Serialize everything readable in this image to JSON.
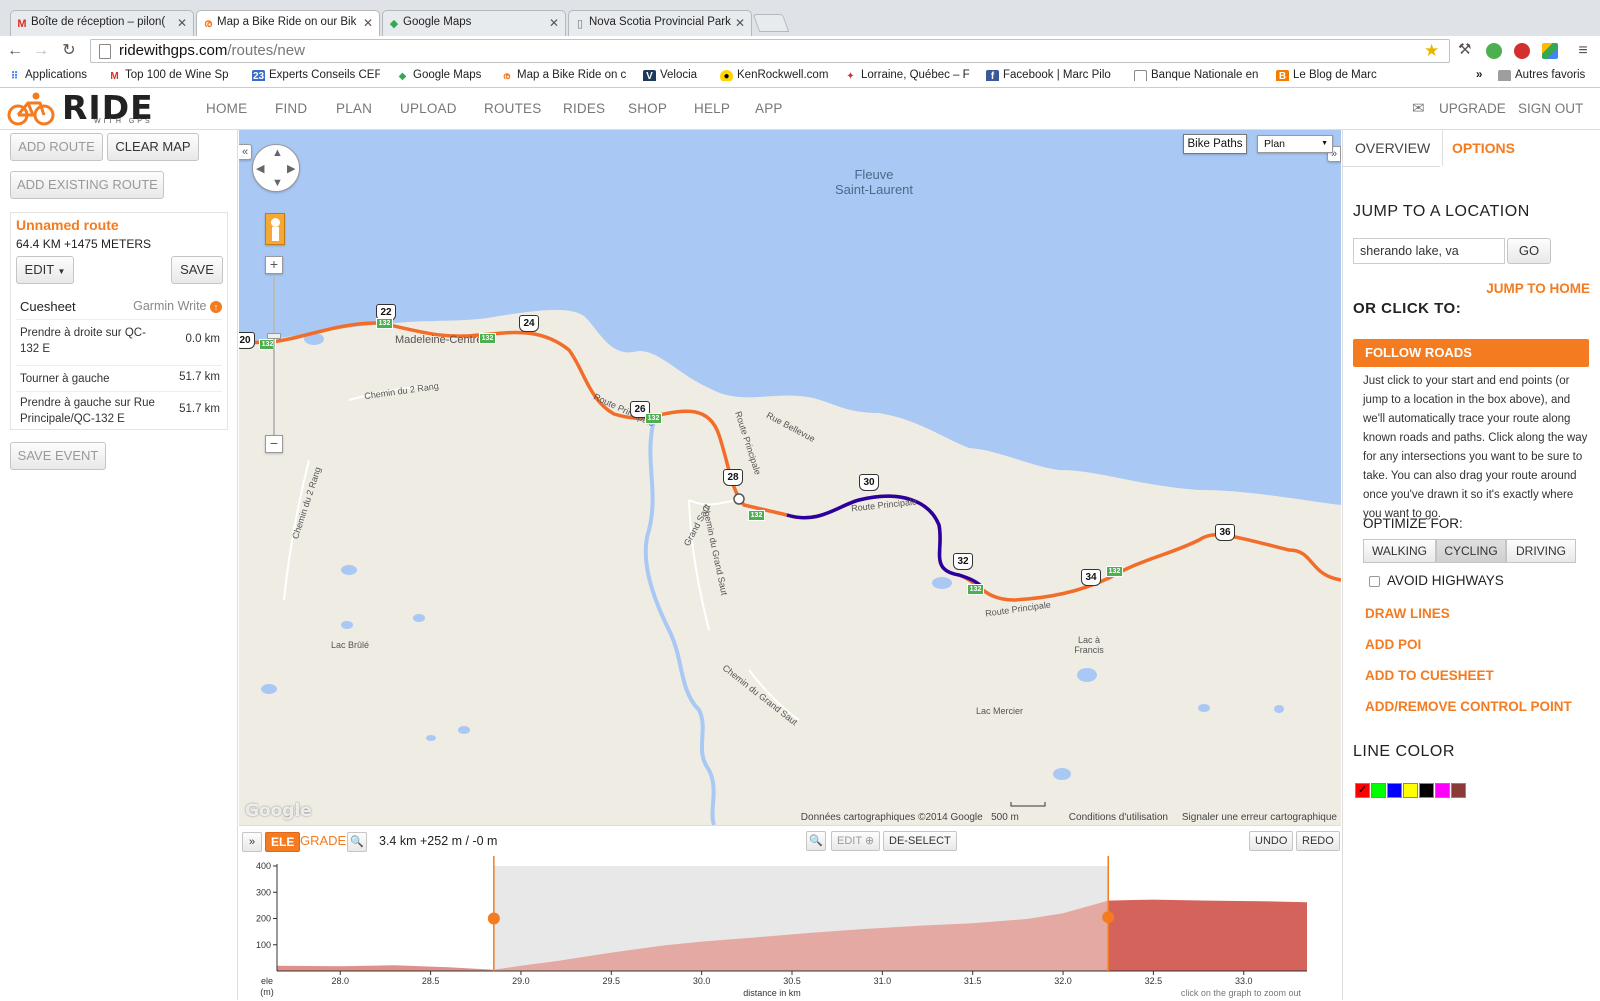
{
  "browser": {
    "tabs": [
      {
        "title": "Boîte de réception – pilon(",
        "icon": "gmail-icon"
      },
      {
        "title": "Map a Bike Ride on our Bik",
        "icon": "ridewithgps-icon"
      },
      {
        "title": "Google Maps",
        "icon": "google-maps-icon"
      },
      {
        "title": "Nova Scotia Provincial Park",
        "icon": "page-icon"
      }
    ],
    "url_host": "ridewithgps.com",
    "url_path": "/routes/new",
    "bookmarks": [
      "Applications",
      "Top 100 de Wine Sp",
      "Experts Conseils CEF",
      "Google Maps",
      "Map a Bike Ride on c",
      "Velocia",
      "KenRockwell.com",
      "Lorraine, Québec – F",
      "Facebook | Marc Pilo",
      "Banque Nationale en",
      "Le Blog de Marc"
    ],
    "bookmarks_overflow": "»",
    "other_bookmarks": "Autres favoris"
  },
  "site": {
    "logo_text": "RIDE",
    "logo_sub": "WITH GPS",
    "nav": [
      "HOME",
      "FIND",
      "PLAN",
      "UPLOAD",
      "ROUTES",
      "RIDES",
      "SHOP",
      "HELP",
      "APP"
    ],
    "upgrade": "UPGRADE",
    "sign_out": "SIGN OUT"
  },
  "left": {
    "add_route": "ADD ROUTE",
    "clear_map": "CLEAR MAP",
    "add_existing": "ADD EXISTING ROUTE",
    "route_name": "Unnamed route",
    "route_stats": "64.4 KM +1475 METERS",
    "edit": "EDIT",
    "save": "SAVE",
    "cuesheet": "Cuesheet",
    "garmin_write": "Garmin Write",
    "cues": [
      {
        "text": "Prendre à droite sur QC-132 E",
        "dist": "0.0 km"
      },
      {
        "text": "Tourner à gauche",
        "dist": "51.7 km"
      },
      {
        "text": "Prendre à gauche sur Rue Principale/QC-132 E",
        "dist": "51.7 km"
      }
    ],
    "save_event": "SAVE EVENT"
  },
  "map": {
    "bike_paths": "Bike Paths",
    "map_type": "Plan",
    "water_label": "Fleuve\nSaint-Laurent",
    "place_labels": [
      "Madeleine-Centre",
      "Chemin du 2 Rang",
      "Route Principale",
      "Rue Bellevue",
      "Route Principale",
      "Route Principale",
      "Route Principale",
      "Grand Saut",
      "Chemin du Grand Saut",
      "Chemin du 2 Rang",
      "Chemin du Grand Saut",
      "Lac Brûlé",
      "Lac à Francis",
      "Lac Mercier"
    ],
    "route_shields": [
      "20",
      "22",
      "24",
      "26",
      "28",
      "30",
      "32",
      "34",
      "36"
    ],
    "road_shields": [
      "132",
      "132",
      "132",
      "132",
      "132",
      "132",
      "132",
      "132"
    ],
    "google": "Google",
    "footer_data": "Données cartographiques ©2014 Google",
    "footer_scale": "500 m",
    "footer_terms": "Conditions d'utilisation",
    "footer_report": "Signaler une erreur cartographique"
  },
  "elevation": {
    "ele": "ELE",
    "grade": "GRADE",
    "readout": "3.4 km +252 m / -0 m",
    "edit": "EDIT",
    "deselect": "DE-SELECT",
    "undo": "UNDO",
    "redo": "REDO",
    "ylabel": "ele\n(m)",
    "xlabel": "distance in km",
    "zoom_hint": "click on the graph to zoom out",
    "y_ticks": [
      "100",
      "200",
      "300",
      "400"
    ],
    "x_ticks": [
      "28.0",
      "28.5",
      "29.0",
      "29.5",
      "30.0",
      "30.5",
      "31.0",
      "31.5",
      "32.0",
      "32.5",
      "33.0"
    ],
    "selection_km": [
      28.85,
      32.25
    ],
    "x_range": [
      27.65,
      33.35
    ],
    "y_range": [
      0,
      400
    ],
    "profile": [
      [
        27.65,
        20
      ],
      [
        28.0,
        18
      ],
      [
        28.3,
        22
      ],
      [
        28.6,
        14
      ],
      [
        28.85,
        5
      ],
      [
        29.0,
        20
      ],
      [
        29.2,
        38
      ],
      [
        29.5,
        70
      ],
      [
        29.8,
        98
      ],
      [
        30.0,
        112
      ],
      [
        30.3,
        128
      ],
      [
        30.6,
        145
      ],
      [
        30.9,
        160
      ],
      [
        31.2,
        172
      ],
      [
        31.5,
        182
      ],
      [
        31.8,
        198
      ],
      [
        32.0,
        220
      ],
      [
        32.25,
        268
      ],
      [
        32.5,
        272
      ],
      [
        32.8,
        268
      ],
      [
        33.1,
        266
      ],
      [
        33.35,
        262
      ]
    ],
    "colors": {
      "outside": "#e0908a",
      "selected": "#e3a9a2",
      "after": "#d4635c",
      "marker": "#f47b20"
    }
  },
  "right": {
    "tab_overview": "OVERVIEW",
    "tab_options": "OPTIONS",
    "jump_title": "JUMP TO A LOCATION",
    "jump_value": "sherando lake, va",
    "go": "GO",
    "jump_home": "JUMP TO HOME",
    "or_click": "OR CLICK TO:",
    "follow_roads": "FOLLOW ROADS",
    "follow_desc": "Just click to your start and end points (or jump to a location in the box above), and we'll automatically trace your route along known roads and paths. Click along the way for any intersections you want to be sure to take. You can also drag your route around once you've drawn it so it's exactly where you want to go.",
    "optimize_for": "OPTIMIZE FOR:",
    "walking": "WALKING",
    "cycling": "CYCLING",
    "driving": "DRIVING",
    "avoid_highways": "AVOID HIGHWAYS",
    "draw_lines": "DRAW LINES",
    "add_poi": "ADD POI",
    "add_cuesheet": "ADD TO CUESHEET",
    "add_control": "ADD/REMOVE CONTROL POINT",
    "line_color": "LINE COLOR",
    "swatches": [
      "#ff0000",
      "#00ff00",
      "#0000ff",
      "#ffff00",
      "#000000",
      "#ff00ff",
      "#8b3a3a"
    ]
  },
  "colors": {
    "accent": "#f47b20",
    "route": "#f26d2a",
    "route_selected": "#2a00a0",
    "water": "#a9c8f4"
  }
}
